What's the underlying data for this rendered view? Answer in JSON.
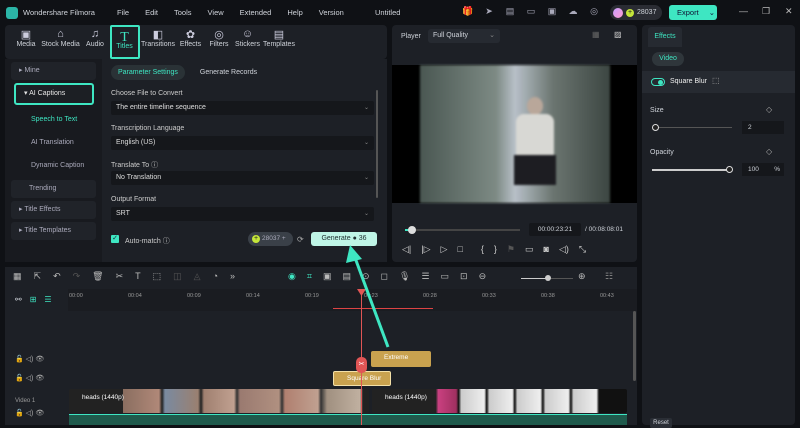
{
  "app": {
    "name": "Wondershare Filmora",
    "menu": [
      "File",
      "Edit",
      "Tools",
      "View",
      "Extended",
      "Help",
      "Version"
    ],
    "doc_title": "Untitled",
    "credits": "28037",
    "export_label": "Export"
  },
  "toolbar": [
    {
      "label": "Media",
      "icon": "media-icon"
    },
    {
      "label": "Stock Media",
      "icon": "stock-media-icon"
    },
    {
      "label": "Audio",
      "icon": "audio-icon"
    },
    {
      "label": "Titles",
      "icon": "titles-icon"
    },
    {
      "label": "Transitions",
      "icon": "transitions-icon"
    },
    {
      "label": "Effects",
      "icon": "effects-icon"
    },
    {
      "label": "Filters",
      "icon": "filters-icon"
    },
    {
      "label": "Stickers",
      "icon": "stickers-icon"
    },
    {
      "label": "Templates",
      "icon": "templates-icon"
    }
  ],
  "sidebar": {
    "mine": "Mine",
    "ai_captions": "AI Captions",
    "sub": [
      "Speech to Text",
      "AI Translation",
      "Dynamic Caption"
    ],
    "trending": "Trending",
    "title_effects": "Title Effects",
    "title_templates": "Title Templates"
  },
  "captions": {
    "tabs": [
      "Parameter Settings",
      "Generate Records"
    ],
    "file_label": "Choose File to Convert",
    "file_value": "The entire timeline sequence",
    "lang_label": "Transcription Language",
    "lang_value": "English (US)",
    "translate_label": "Translate To",
    "translate_value": "No Translation",
    "format_label": "Output Format",
    "format_value": "SRT",
    "auto_match": "Auto-match",
    "credits": "28037",
    "generate_label": "Generate",
    "generate_cost": "36"
  },
  "player": {
    "label": "Player",
    "quality": "Full Quality",
    "current_time": "00:00:23:21",
    "total_time": "00:08:08:01",
    "progress_pct": 5
  },
  "effects": {
    "tab": "Effects",
    "subtab": "Video",
    "effect_name": "Square Blur",
    "size_label": "Size",
    "size_value": "2",
    "opacity_label": "Opacity",
    "opacity_value": "100",
    "opacity_unit": "%",
    "reset": "Reset"
  },
  "timeline": {
    "ticks": [
      "00:00",
      "00:04",
      "00:09",
      "00:14",
      "00:19",
      "00:23",
      "00:28",
      "00:33",
      "00:38",
      "00:43"
    ],
    "clips": {
      "extreme": "Extreme",
      "square_blur": "Square Blur",
      "video1": "heads (1440p)",
      "video2": "heads (1440p)"
    },
    "track_label": "Video 1"
  }
}
